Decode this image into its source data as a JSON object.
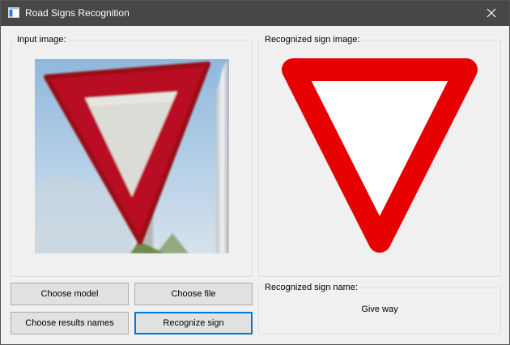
{
  "window": {
    "title": "Road Signs Recognition",
    "app_icon": "app-window-icon",
    "close_icon": "close-icon"
  },
  "input_panel": {
    "title": "Input image:",
    "image": "yield-sign-photo"
  },
  "recognized_panel": {
    "title": "Recognized sign image:",
    "image": "yield-sign-graphic"
  },
  "name_panel": {
    "title": "Recognized sign name:",
    "value": "Give way"
  },
  "buttons": {
    "choose_model": "Choose model",
    "choose_file": "Choose file",
    "choose_results_names": "Choose results names",
    "recognize_sign": "Recognize sign"
  },
  "colors": {
    "titlebar": "#474747",
    "window_bg": "#f0f0f0",
    "button_bg": "#e1e1e1",
    "focus_border": "#0078d7",
    "sign_red": "#e60000"
  }
}
